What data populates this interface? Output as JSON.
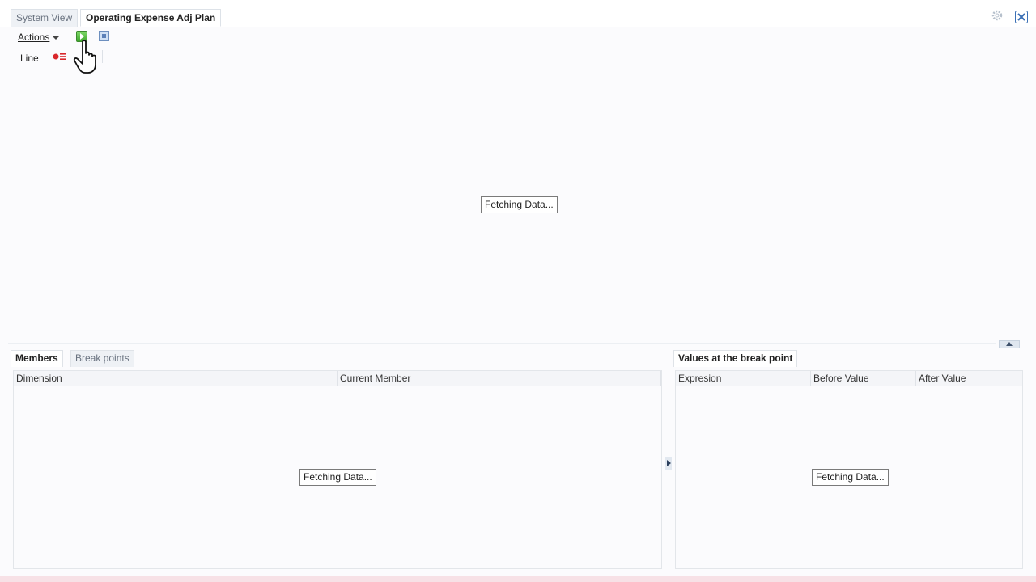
{
  "tabs": {
    "system_view": "System View",
    "active": "Operating Expense Adj Plan"
  },
  "toolbar": {
    "actions_label": "Actions",
    "run_icon": "run-icon",
    "stop_icon": "stop-icon"
  },
  "line_row": {
    "line_label": "Line",
    "breakpoint_icon": "breakpoint-toggle-icon"
  },
  "main": {
    "fetching": "Fetching Data..."
  },
  "bottom_left": {
    "tabs": [
      "Members",
      "Break points"
    ],
    "columns": [
      "Dimension",
      "Current Member"
    ],
    "fetching": "Fetching Data..."
  },
  "bottom_right": {
    "title": "Values at the break point",
    "columns": [
      "Expresion",
      "Before Value",
      "After Value"
    ],
    "fetching": "Fetching Data..."
  },
  "colors": {
    "accent": "#3fa62e",
    "close_icon": "#3a6fb5"
  }
}
